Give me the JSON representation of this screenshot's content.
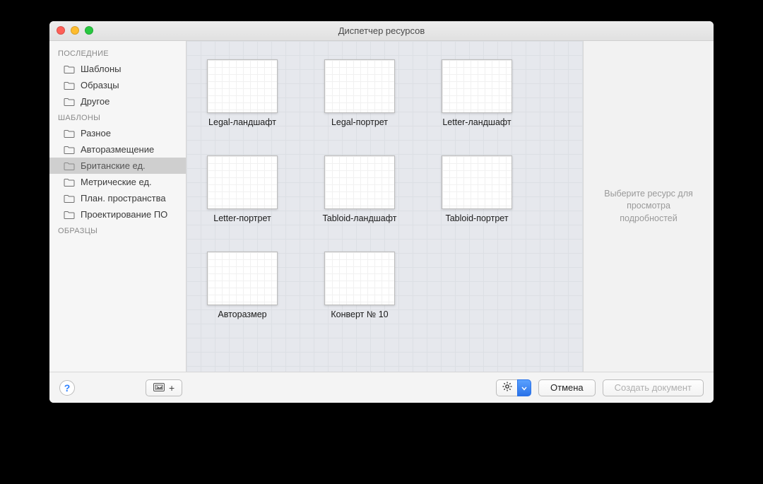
{
  "window": {
    "title": "Диспетчер ресурсов"
  },
  "sidebar": {
    "sections": [
      {
        "header": "ПОСЛЕДНИЕ",
        "items": [
          {
            "label": "Шаблоны"
          },
          {
            "label": "Образцы"
          },
          {
            "label": "Другое"
          }
        ]
      },
      {
        "header": "ШАБЛОНЫ",
        "items": [
          {
            "label": "Разное"
          },
          {
            "label": "Авторазмещение"
          },
          {
            "label": "Британские ед.",
            "selected": true
          },
          {
            "label": "Метрические ед."
          },
          {
            "label": "План. пространства"
          },
          {
            "label": "Проектирование ПО"
          }
        ]
      },
      {
        "header": "ОБРАЗЦЫ",
        "items": []
      }
    ]
  },
  "templates": [
    {
      "label": "Legal-ландшафт"
    },
    {
      "label": "Legal-портрет"
    },
    {
      "label": "Letter-ландшафт"
    },
    {
      "label": "Letter-портрет"
    },
    {
      "label": "Tabloid-ландшафт"
    },
    {
      "label": "Tabloid-портрет"
    },
    {
      "label": "Авторазмер"
    },
    {
      "label": "Конверт № 10"
    }
  ],
  "inspector": {
    "message": "Выберите ресурс для просмотра подробностей"
  },
  "footer": {
    "help": "?",
    "import_plus": "+",
    "cancel": "Отмена",
    "create": "Создать документ"
  }
}
